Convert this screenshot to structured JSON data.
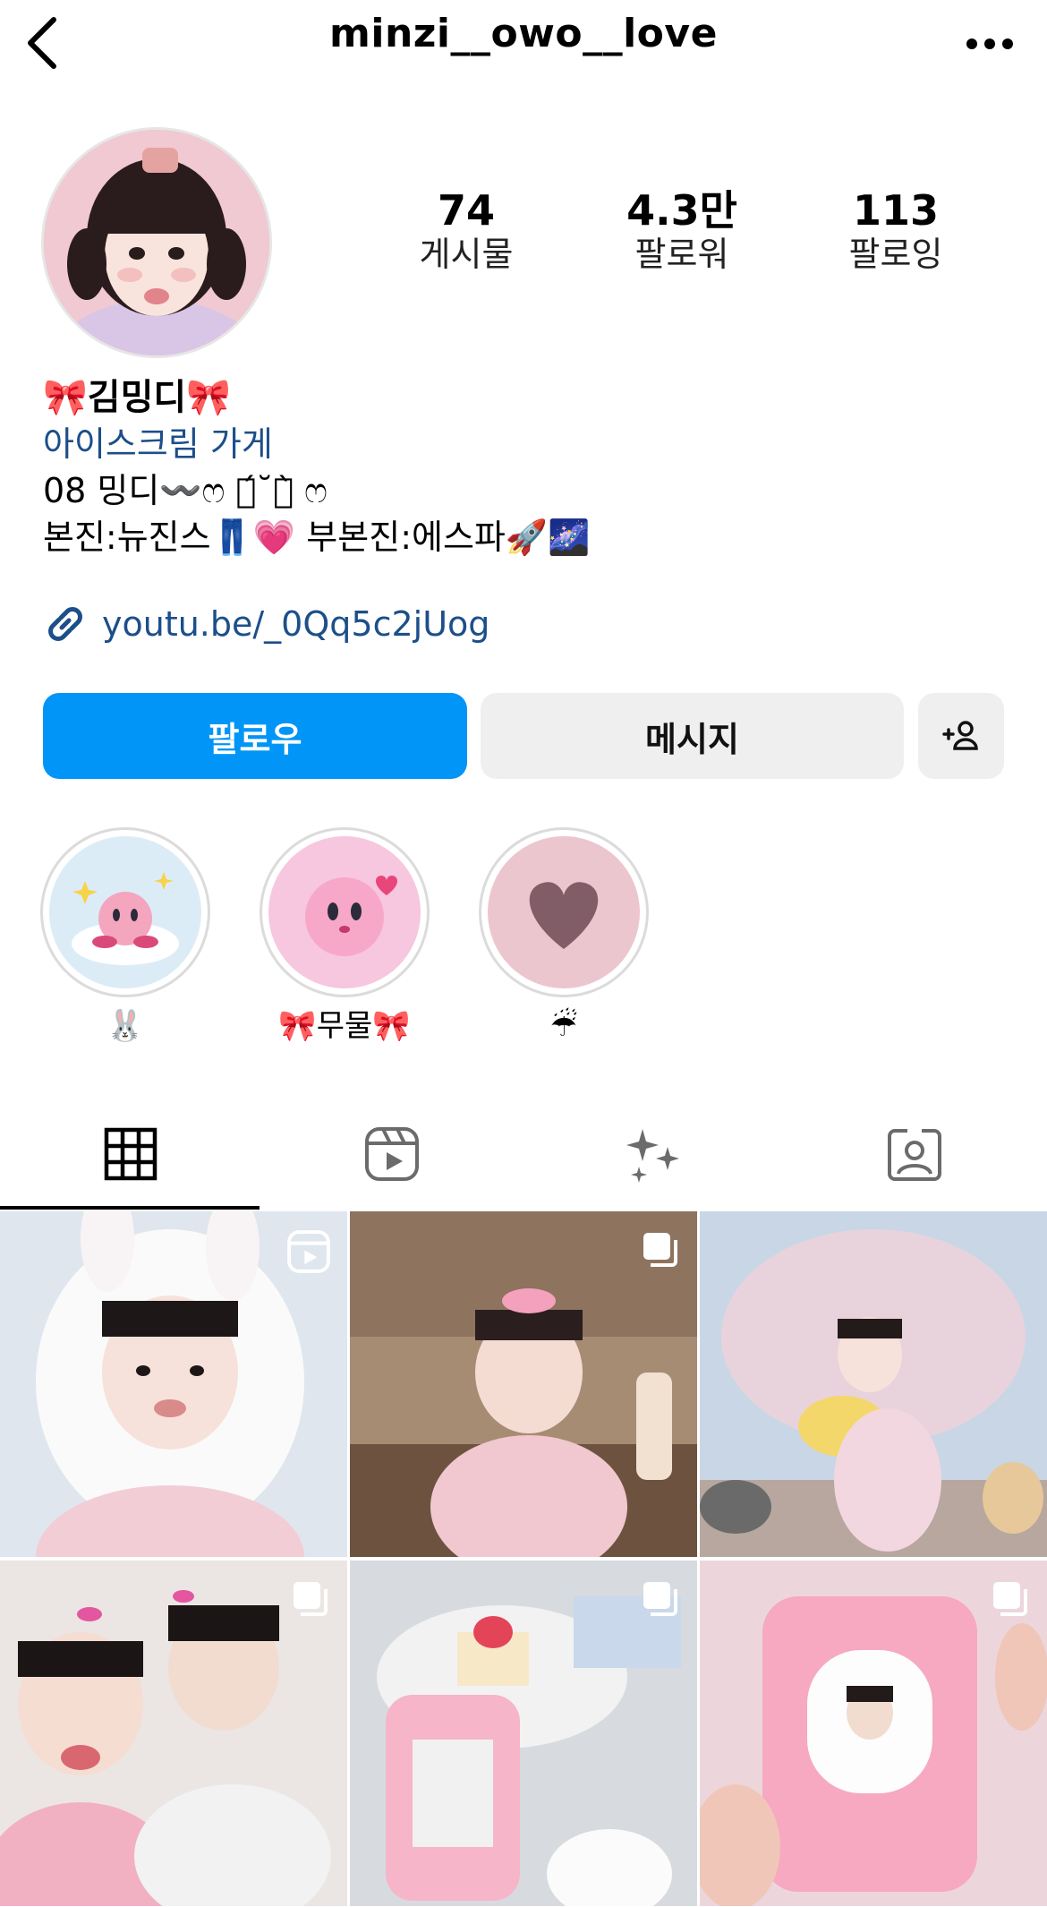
{
  "header": {
    "username": "minzi__owo__love"
  },
  "stats": [
    {
      "value": "74",
      "label": "게시물"
    },
    {
      "value": "4.3만",
      "label": "팔로워"
    },
    {
      "value": "113",
      "label": "팔로잉"
    }
  ],
  "bio": {
    "name": "🎀김밍디🎀",
    "category": "아이스크림 가게",
    "line1": "08 밍디〰️ෆ ต́˘ต̀ ෆ",
    "line2": "본진:뉴진스👖💗 부본진:에스파🚀🌌",
    "link": "youtu.be/_0Qq5c2jUog"
  },
  "actions": {
    "follow": "팔로우",
    "message": "메시지"
  },
  "highlights": [
    {
      "label": "🐰"
    },
    {
      "label": "🎀무물🎀"
    },
    {
      "label": "☔"
    }
  ],
  "tabs": [
    "posts",
    "reels",
    "tagged-ai",
    "tagged"
  ],
  "posts": [
    {
      "type": "reel"
    },
    {
      "type": "carousel"
    },
    {
      "type": "photo"
    },
    {
      "type": "carousel"
    },
    {
      "type": "carousel"
    },
    {
      "type": "carousel"
    }
  ],
  "colors": {
    "accent": "#0095f6",
    "link": "#1c4f8a",
    "button_secondary": "#efefef"
  }
}
